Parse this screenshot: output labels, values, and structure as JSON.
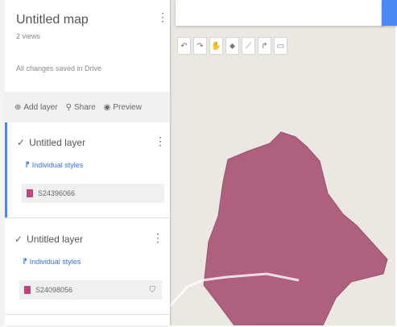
{
  "sidebar": {
    "title": "Untitled map",
    "views": "2 views",
    "saved_status": "All changes saved in Drive",
    "actions": [
      {
        "label": "Add layer",
        "icon": "add-layer-icon"
      },
      {
        "label": "Share",
        "icon": "share-icon"
      },
      {
        "label": "Preview",
        "icon": "preview-icon"
      }
    ],
    "layers": [
      {
        "name": "Untitled layer",
        "styles_label": "Individual styles",
        "feature": "S24396066"
      },
      {
        "name": "Untitled layer",
        "styles_label": "Individual styles",
        "feature": "S24098056"
      }
    ]
  },
  "map": {
    "toolbar": [
      "undo",
      "redo",
      "hand",
      "marker",
      "line",
      "route",
      "ruler"
    ],
    "polygon_color": "#b0607f"
  }
}
